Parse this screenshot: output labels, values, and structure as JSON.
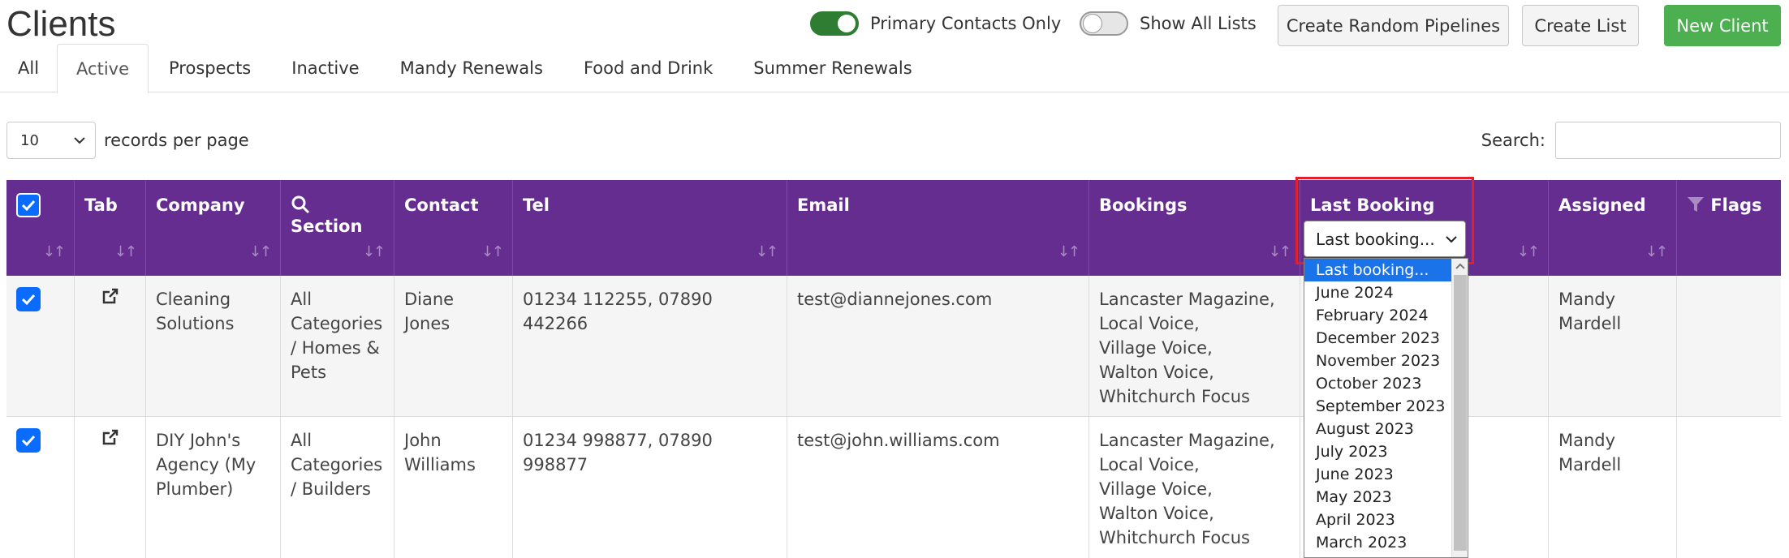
{
  "page": {
    "title": "Clients"
  },
  "toggles": {
    "primary": {
      "label": "Primary Contacts Only",
      "state": "on"
    },
    "show_all": {
      "label": "Show All Lists",
      "state": "off"
    }
  },
  "buttons": {
    "random_pipelines": "Create Random Pipelines",
    "create_list": "Create List",
    "new_client": "New Client"
  },
  "tabs": [
    "All",
    "Active",
    "Prospects",
    "Inactive",
    "Mandy Renewals",
    "Food and Drink",
    "Summer Renewals"
  ],
  "active_tab": "Active",
  "records": {
    "value": "10",
    "label": "records per page"
  },
  "search": {
    "label": "Search:",
    "value": ""
  },
  "table": {
    "headers": {
      "tab": "Tab",
      "company": "Company",
      "section": "Section",
      "contact": "Contact",
      "tel": "Tel",
      "email": "Email",
      "bookings": "Bookings",
      "last_booking": "Last Booking",
      "assigned": "Assigned",
      "flags": "Flags"
    },
    "rows": [
      {
        "company": "Cleaning Solutions",
        "section": "All Categories / Homes & Pets",
        "contact": "Diane Jones",
        "tel": "01234 112255, 07890 442266",
        "email": "test@diannejones.com",
        "bookings": [
          "Lancaster Magazine,",
          "Local Voice,",
          "Village Voice,",
          "Walton Voice,",
          "Whitchurch Focus"
        ],
        "assigned": "Mandy Mardell"
      },
      {
        "company": "DIY John's Agency (My Plumber)",
        "section": "All Categories / Builders",
        "contact": "John Williams",
        "tel": "01234 998877, 07890 998877",
        "email": "test@john.williams.com",
        "bookings": [
          "Lancaster Magazine,",
          "Local Voice,",
          "Village Voice,",
          "Walton Voice,",
          "Whitchurch Focus"
        ],
        "assigned": "Mandy Mardell"
      }
    ]
  },
  "last_booking_filter": {
    "selected": "Last booking...",
    "options": [
      "Last booking...",
      "June 2024",
      "February 2024",
      "December 2023",
      "November 2023",
      "October 2023",
      "September 2023",
      "August 2023",
      "July 2023",
      "June 2023",
      "May 2023",
      "April 2023",
      "March 2023"
    ]
  },
  "colors": {
    "header": "#662d91",
    "accent_green": "#4caf50",
    "highlight": "#e0202a",
    "checkbox": "#0a6cff"
  },
  "icons": {
    "sort": "sort-icon",
    "search": "search-icon",
    "filter": "filter-icon",
    "external": "external-link-icon",
    "check": "check-icon"
  }
}
